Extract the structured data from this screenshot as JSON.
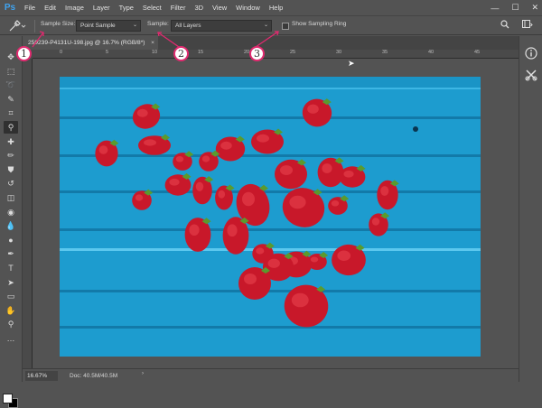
{
  "app": {
    "logo": "Ps"
  },
  "menu": [
    "File",
    "Edit",
    "Image",
    "Layer",
    "Type",
    "Select",
    "Filter",
    "3D",
    "View",
    "Window",
    "Help"
  ],
  "window_controls": {
    "minimize": "—",
    "maximize": "☐",
    "close": "✕"
  },
  "options": {
    "sample_size_label": "Sample Size:",
    "sample_size_value": "Point Sample",
    "sample_label": "Sample:",
    "sample_value": "All Layers",
    "sampling_ring_label": "Show Sampling Ring",
    "sampling_ring_checked": false
  },
  "document": {
    "tab_title": "259239-P4131U-198.jpg @ 16.7% (RGB/8*)",
    "tab_close": "×"
  },
  "rulers": {
    "top": [
      "0",
      "5",
      "10",
      "15",
      "20",
      "25",
      "30",
      "35",
      "40",
      "45"
    ]
  },
  "status": {
    "zoom": "16.67%",
    "doc": "Doc: 40.5M/40.5M",
    "arrow": "›"
  },
  "callouts": [
    "1",
    "2",
    "3"
  ],
  "colors": {
    "accent": "#e02a6f",
    "ui_bg": "#535353",
    "canvas_blue": "#1d9ccf",
    "strawberry": "#c8182a",
    "leaf": "#5a9a2e"
  },
  "tools": [
    {
      "name": "move-tool",
      "icon": "✥"
    },
    {
      "name": "marquee-tool",
      "icon": "⬚"
    },
    {
      "name": "lasso-tool",
      "icon": "➰"
    },
    {
      "name": "quick-select-tool",
      "icon": "✎"
    },
    {
      "name": "crop-tool",
      "icon": "⌗"
    },
    {
      "name": "eyedropper-tool",
      "icon": "⚲"
    },
    {
      "name": "healing-brush-tool",
      "icon": "✚"
    },
    {
      "name": "brush-tool",
      "icon": "✏"
    },
    {
      "name": "clone-stamp-tool",
      "icon": "⛊"
    },
    {
      "name": "history-brush-tool",
      "icon": "↺"
    },
    {
      "name": "eraser-tool",
      "icon": "◫"
    },
    {
      "name": "paint-bucket-tool",
      "icon": "◉"
    },
    {
      "name": "blur-tool",
      "icon": "💧"
    },
    {
      "name": "dodge-tool",
      "icon": "●"
    },
    {
      "name": "pen-tool",
      "icon": "✒"
    },
    {
      "name": "type-tool",
      "icon": "T"
    },
    {
      "name": "path-select-tool",
      "icon": "➤"
    },
    {
      "name": "shape-tool",
      "icon": "▭"
    },
    {
      "name": "hand-tool",
      "icon": "✋"
    },
    {
      "name": "zoom-tool",
      "icon": "⚲"
    },
    {
      "name": "more-tools",
      "icon": "…"
    }
  ]
}
